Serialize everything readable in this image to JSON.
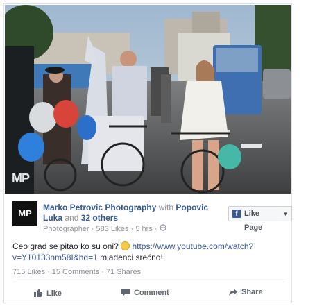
{
  "photo": {
    "watermark": "MP"
  },
  "post": {
    "avatar_text": "MP",
    "page_name": "Marko Petrovic Photography",
    "with_text": "with",
    "tagged": "Popovic Luka",
    "and_text": "and",
    "others": "32 others",
    "category": "Photographer",
    "likes_page": "583 Likes",
    "time": "5 hrs",
    "like_page_label": "Like Page",
    "text_before": "Ceo grad se pitao ko su oni?",
    "link": "https://www.youtube.com/watch?v=Y10133nm58I&hd=1",
    "text_after": "mladenci srećno!"
  },
  "stats": {
    "likes": "715 Likes",
    "comments": "15 Comments",
    "shares": "71 Shares"
  },
  "actions": {
    "like": "Like",
    "comment": "Comment",
    "share": "Share"
  },
  "colors": {
    "link": "#365899",
    "meta": "#90949c",
    "fb_blue": "#3b5998"
  }
}
